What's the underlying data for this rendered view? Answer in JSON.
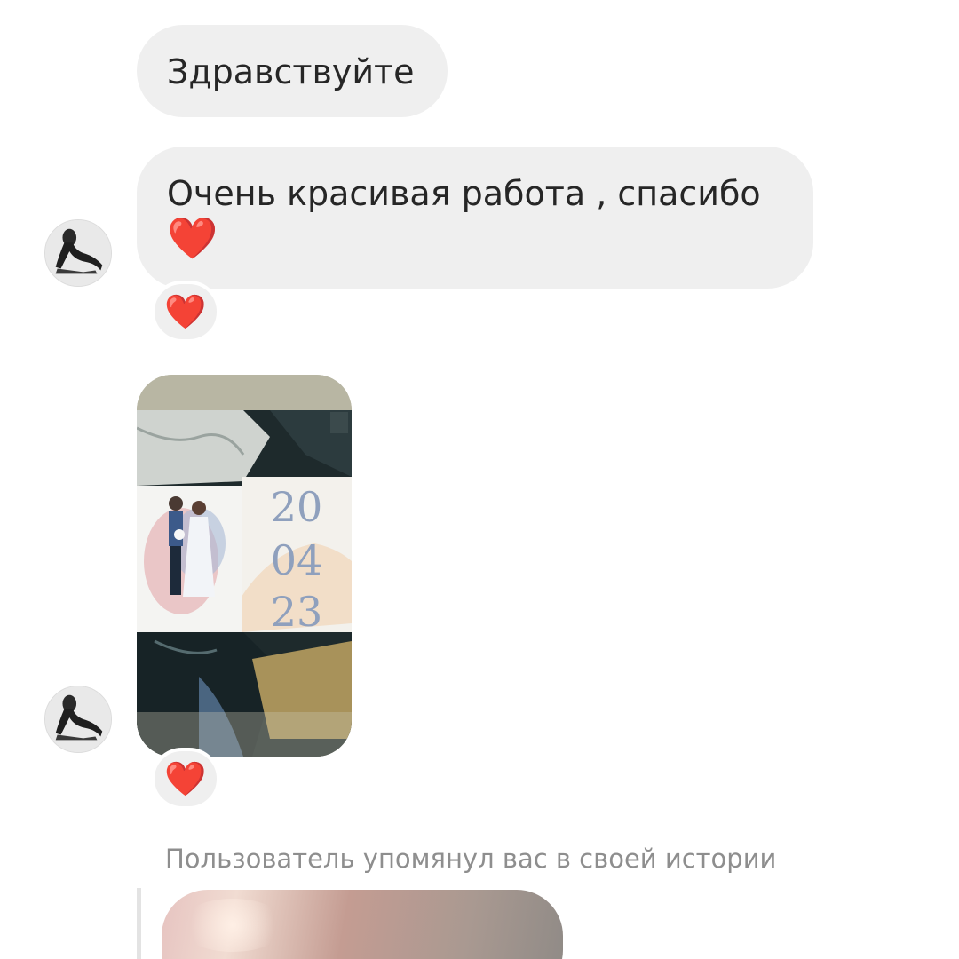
{
  "messages": [
    {
      "text": "Здравствуйте"
    },
    {
      "line1": "Очень красивая работа , спасибо",
      "emoji": "❤️"
    }
  ],
  "reactions": {
    "message2": "❤️",
    "photo": "❤️"
  },
  "photo": {
    "date_day": "20",
    "date_month": "04",
    "date_year": "23"
  },
  "mention": {
    "text": "Пользователь упомянул вас в своей истории"
  },
  "colors": {
    "bubble": "#efefef",
    "text": "#262626",
    "meta": "#8e8e8e",
    "heart": "#e0182d"
  },
  "icons": {
    "heart": "red-heart-icon",
    "avatar": "user-avatar"
  }
}
